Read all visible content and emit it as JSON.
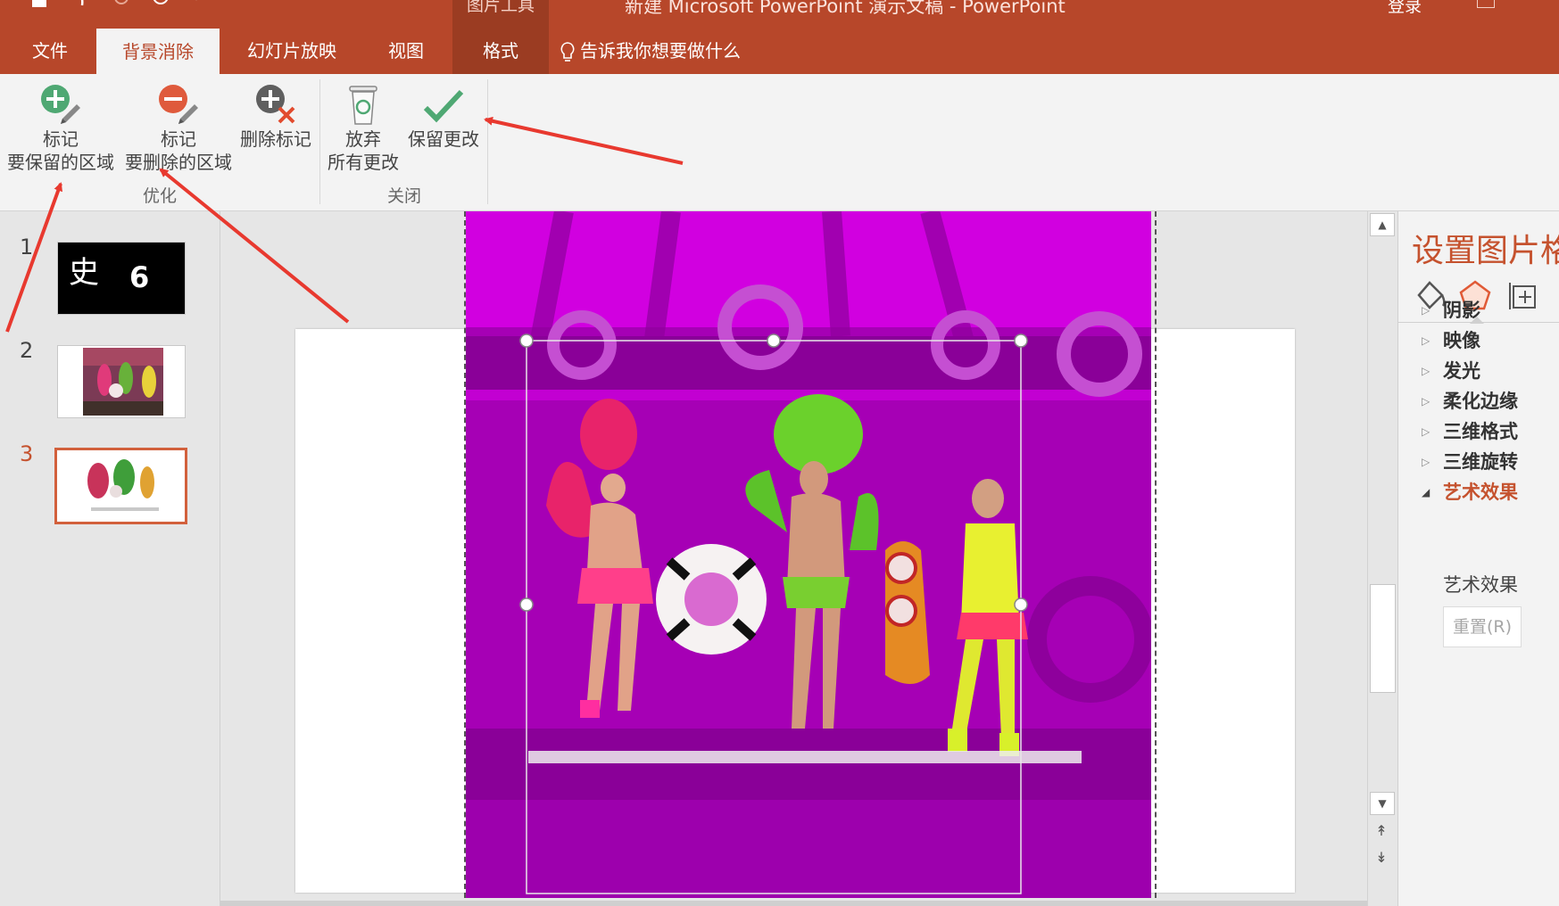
{
  "window": {
    "title": "新建 Microsoft PowerPoint 演示文稿  -  PowerPoint",
    "context_label": "图片工具",
    "sign_in": "登录"
  },
  "tabs": [
    {
      "label": "文件"
    },
    {
      "label": "背景消除",
      "active": true
    },
    {
      "label": "幻灯片放映"
    },
    {
      "label": "视图"
    },
    {
      "label": "格式",
      "context": true
    }
  ],
  "tell_me": "告诉我你想要做什么",
  "ribbon": {
    "refine_group": "优化",
    "close_group": "关闭",
    "mark_keep": {
      "line1": "标记",
      "line2": "要保留的区域"
    },
    "mark_remove": {
      "line1": "标记",
      "line2": "要删除的区域"
    },
    "delete_mark": "删除标记",
    "discard": {
      "line1": "放弃",
      "line2": "所有更改"
    },
    "keep_changes": "保留更改"
  },
  "slides": [
    {
      "number": "1",
      "thumb_text_1": "史",
      "thumb_text_2": "6"
    },
    {
      "number": "2"
    },
    {
      "number": "3",
      "active": true
    }
  ],
  "format_pane": {
    "title": "设置图片格式",
    "sections": [
      {
        "label": "阴影"
      },
      {
        "label": "映像"
      },
      {
        "label": "发光"
      },
      {
        "label": "柔化边缘"
      },
      {
        "label": "三维格式"
      },
      {
        "label": "三维旋转"
      },
      {
        "label": "艺术效果",
        "open": true
      }
    ],
    "sub_label": "艺术效果",
    "reset_button": "重置(R)"
  },
  "colors": {
    "accent": "#b7472a",
    "context_tab": "#9b3c22",
    "removed_area": "#a600b5",
    "annotation": "#e8392f"
  },
  "icons": [
    "save-icon",
    "undo-icon",
    "redo-icon",
    "touch-mode-icon",
    "customize-icon",
    "lightbulb-icon",
    "mark-keep-icon",
    "mark-remove-icon",
    "delete-mark-icon",
    "discard-icon",
    "checkmark-icon",
    "fill-line-icon",
    "effects-icon",
    "size-properties-icon",
    "scroll-up-icon",
    "scroll-down-icon",
    "prev-slide-icon",
    "next-slide-icon"
  ]
}
